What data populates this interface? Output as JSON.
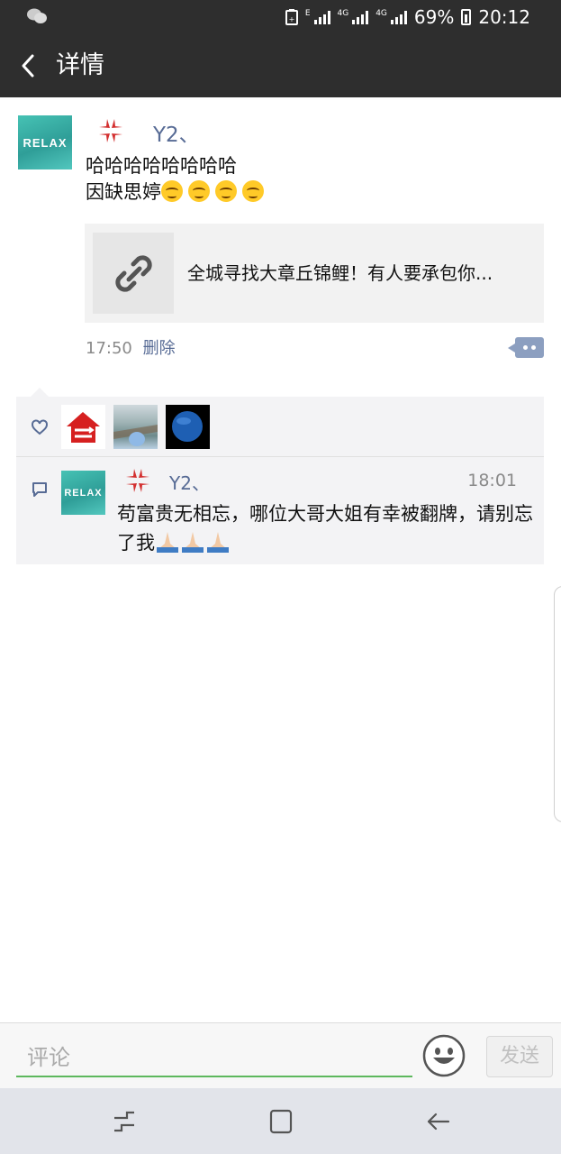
{
  "status_bar": {
    "signal1_label": "E",
    "signal2_label": "4G",
    "signal3_label": "4G",
    "battery": "69%",
    "time": "20:12",
    "icons": [
      "wechat-icon",
      "battery-saver-icon",
      "signal-icon",
      "battery-icon"
    ]
  },
  "header": {
    "title": "详情",
    "back_icon": "chevron-left-icon"
  },
  "post": {
    "author": "Y2、",
    "avatar_text": "RELAX",
    "text_line1": "哈哈哈哈哈哈哈哈",
    "text_line2": "因缺思婷",
    "emoji_count": 4,
    "link_title": "全城寻找大章丘锦鲤！有人要承包你...",
    "time": "17:50",
    "delete_label": "删除"
  },
  "likes": {
    "icon": "heart-icon",
    "count": 3
  },
  "comments": [
    {
      "author": "Y2、",
      "avatar_text": "RELAX",
      "time": "18:01",
      "text": "苟富贵无相忘，哪位大哥大姐有幸被翻牌，请别忘了我"
    }
  ],
  "input": {
    "placeholder": "评论",
    "send_label": "发送"
  },
  "colors": {
    "bar": "#2e2e2e",
    "link_blue": "#576b95",
    "accent_green": "#5db85d"
  }
}
